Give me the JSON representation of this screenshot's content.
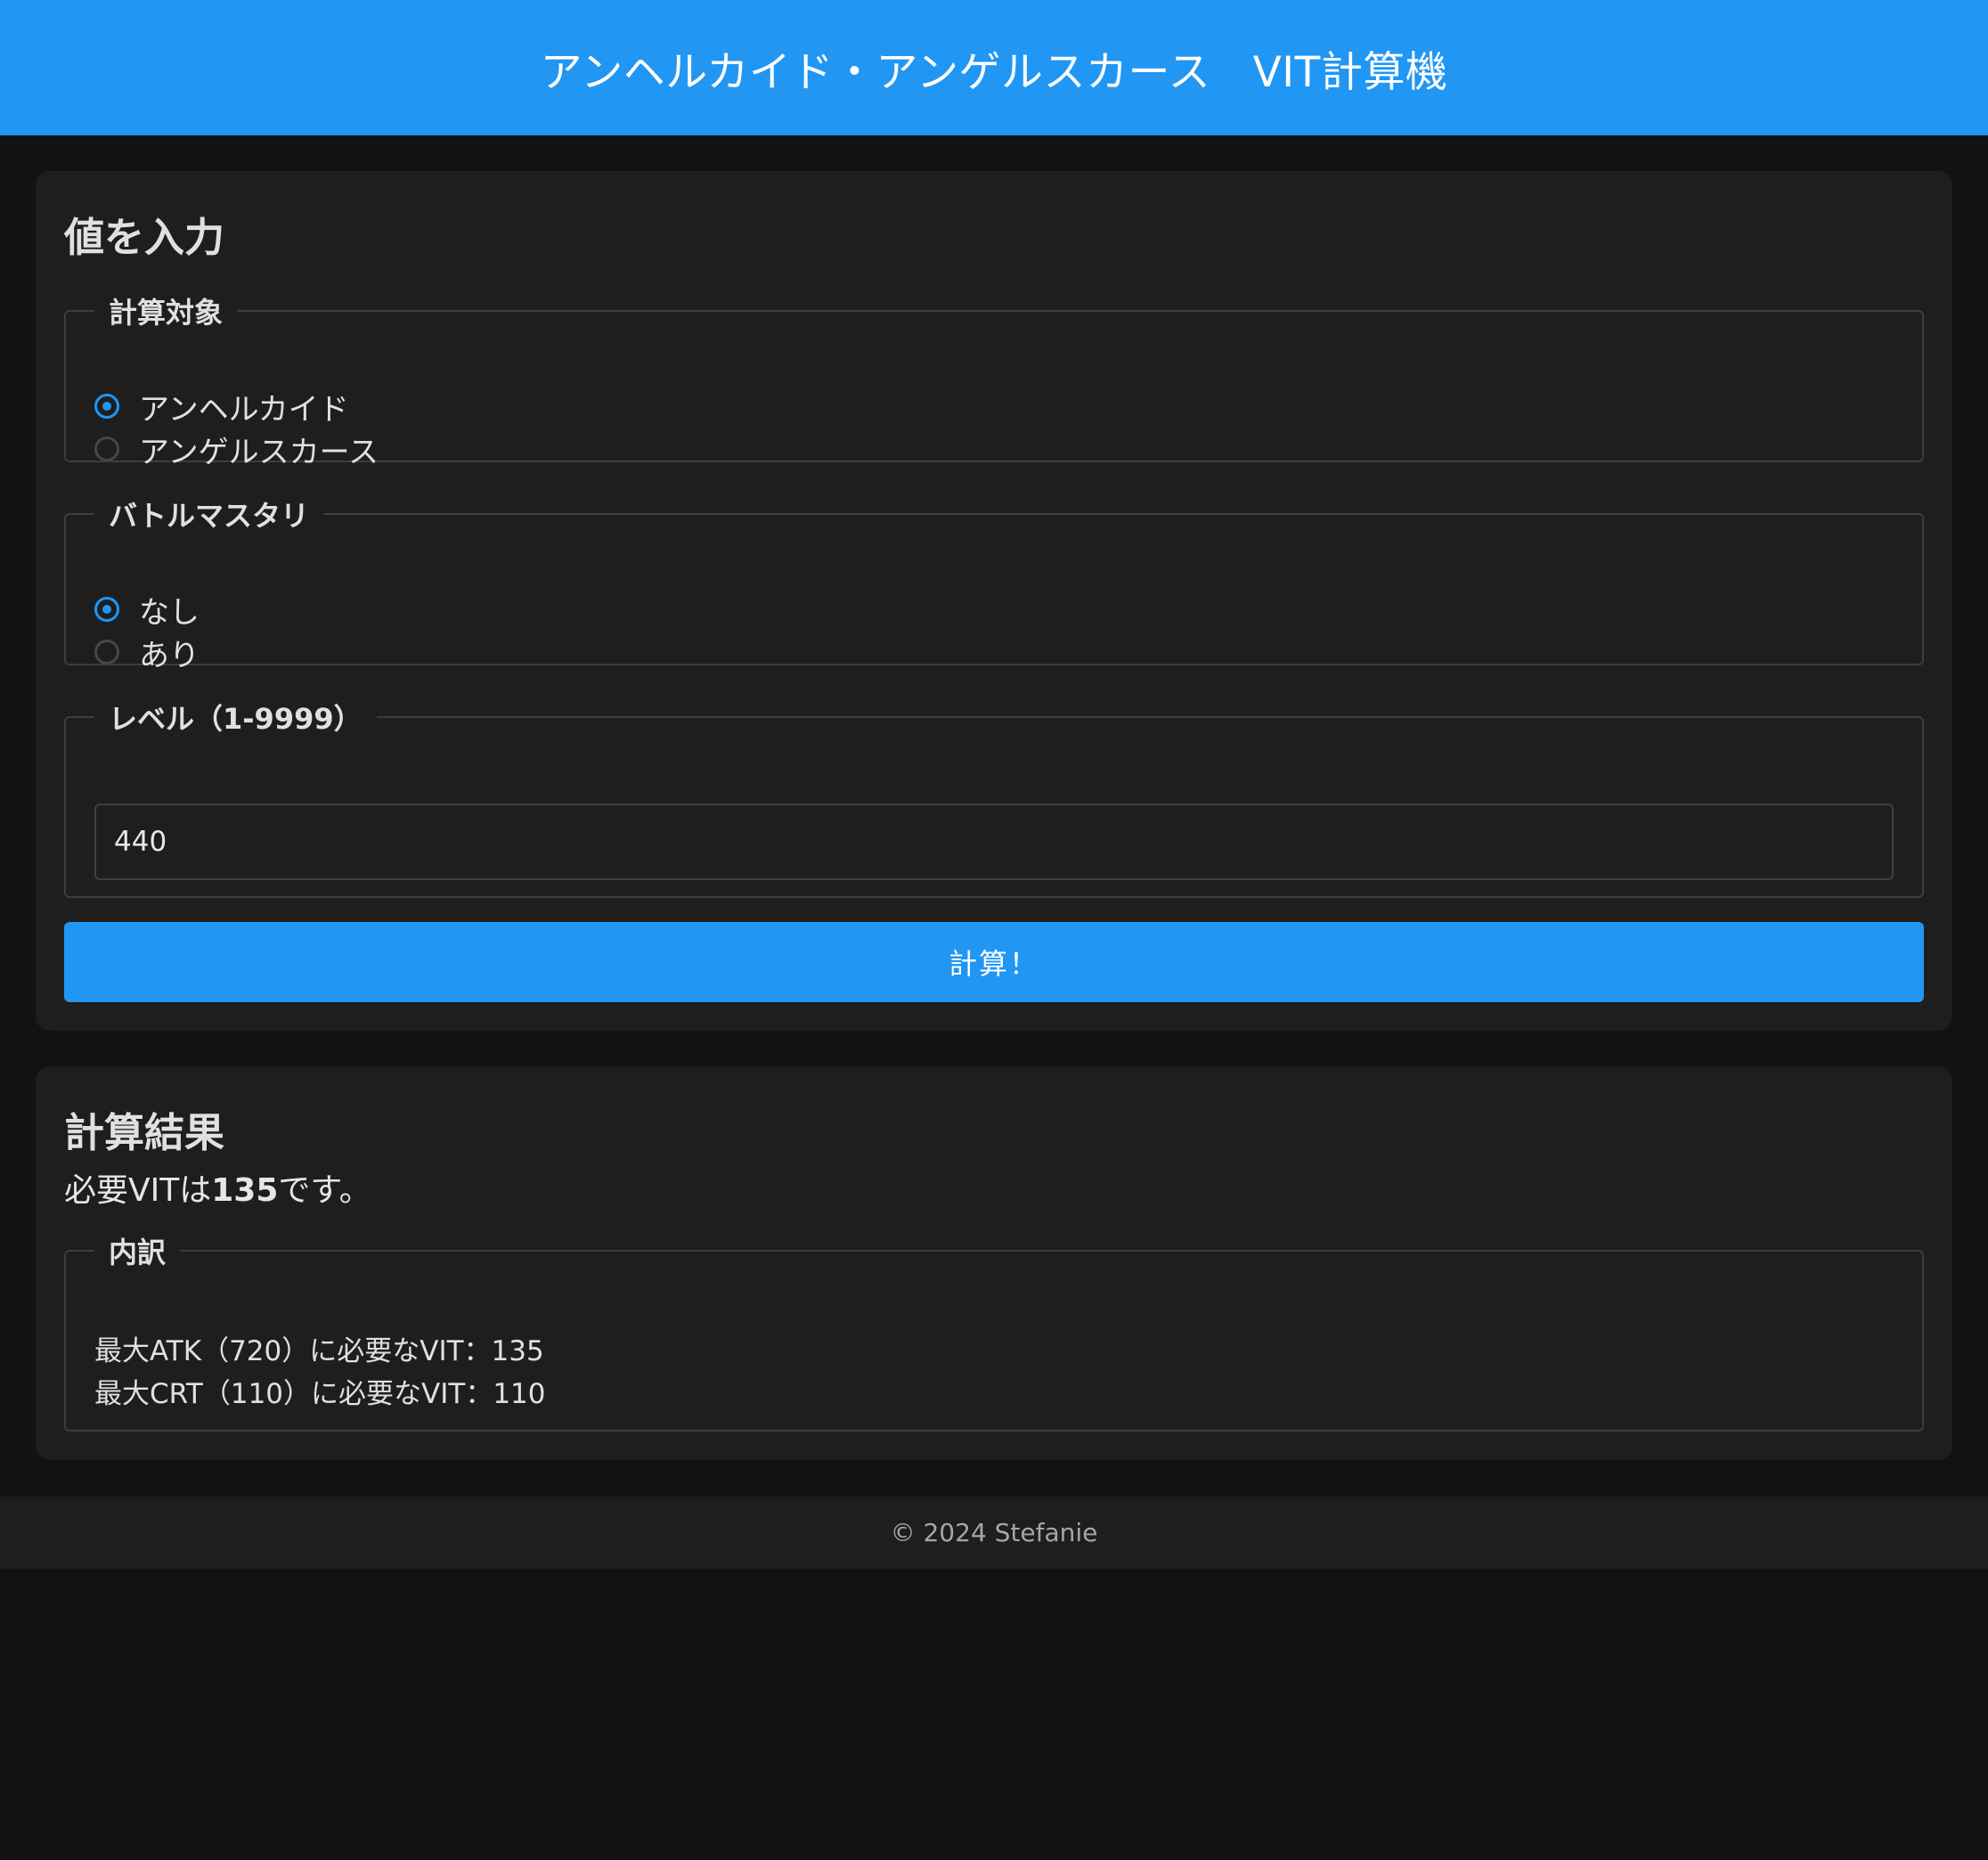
{
  "header": {
    "title": "アンヘルカイド・アンゲルスカース　VIT計算機"
  },
  "input_card": {
    "title": "値を入力",
    "target": {
      "legend": "計算対象",
      "options": [
        "アンヘルカイド",
        "アンゲルスカース"
      ],
      "selected_index": 0
    },
    "battle_mastery": {
      "legend": "バトルマスタリ",
      "options": [
        "なし",
        "あり"
      ],
      "selected_index": 0
    },
    "level": {
      "legend": "レベル（1-9999）",
      "value": "440"
    },
    "calc_button_label": "計算！"
  },
  "result_card": {
    "title": "計算結果",
    "summary_prefix": "必要VITは",
    "summary_value": "135",
    "summary_suffix": "です。",
    "breakdown": {
      "legend": "内訳",
      "lines": [
        "最大ATK（720）に必要なVIT：135",
        "最大CRT（110）に必要なVIT：110"
      ]
    }
  },
  "footer": {
    "text": "© 2024 Stefanie"
  },
  "colors": {
    "accent": "#2196f3",
    "background": "#121212",
    "card": "#1e1e1e"
  }
}
